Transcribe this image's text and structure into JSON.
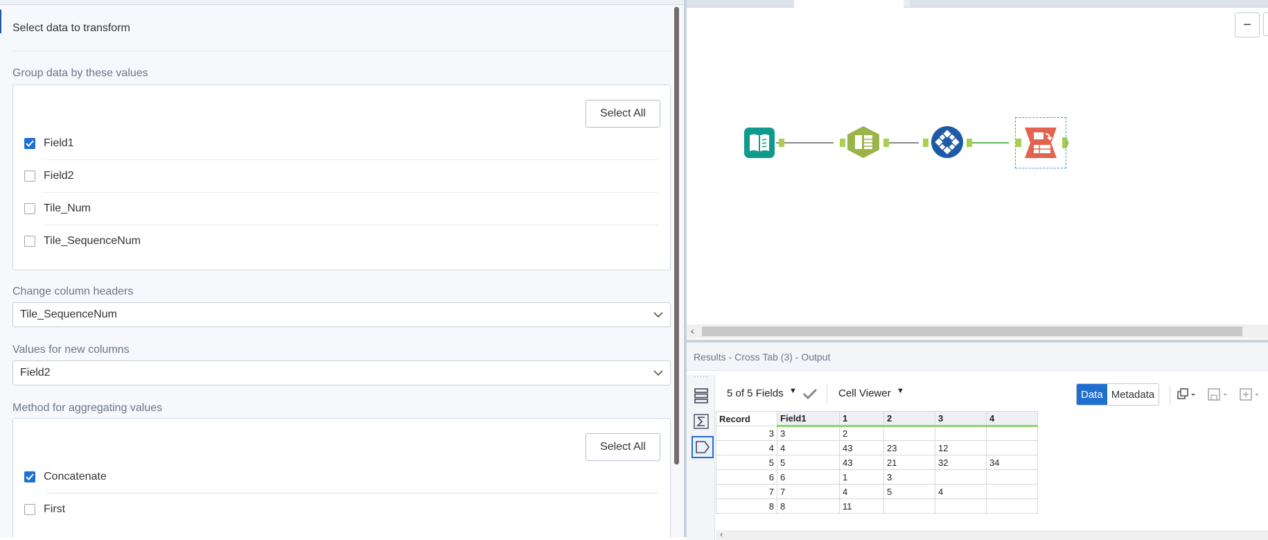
{
  "config": {
    "title": "Select data to transform",
    "group_section": "Group data by these values",
    "group_select_all": "Select All",
    "group_fields": [
      {
        "label": "Field1",
        "checked": true
      },
      {
        "label": "Field2",
        "checked": false
      },
      {
        "label": "Tile_Num",
        "checked": false
      },
      {
        "label": "Tile_SequenceNum",
        "checked": false
      }
    ],
    "headers_section": "Change column headers",
    "headers_value": "Tile_SequenceNum",
    "values_section": "Values for new columns",
    "values_value": "Field2",
    "method_section": "Method for aggregating values",
    "method_select_all": "Select All",
    "methods": [
      {
        "label": "Concatenate",
        "checked": true
      },
      {
        "label": "First",
        "checked": false
      }
    ]
  },
  "canvas": {
    "zoom_out_label": "−",
    "tools": [
      "input-data-tool",
      "text-to-columns-tool",
      "transpose-tool",
      "cross-tab-tool"
    ]
  },
  "results": {
    "header": "Results - Cross Tab (3) - Output",
    "fields_label": "5 of 5 Fields",
    "cell_viewer": "Cell Viewer",
    "tab_data": "Data",
    "tab_metadata": "Metadata",
    "columns": [
      "Record",
      "Field1",
      "1",
      "2",
      "3",
      "4"
    ],
    "rows": [
      [
        "3",
        "3",
        "2",
        "",
        "",
        ""
      ],
      [
        "4",
        "4",
        "43",
        "23",
        "12",
        ""
      ],
      [
        "5",
        "5",
        "43",
        "21",
        "32",
        "34"
      ],
      [
        "6",
        "6",
        "1",
        "3",
        "",
        ""
      ],
      [
        "7",
        "7",
        "4",
        "5",
        "4",
        ""
      ],
      [
        "8",
        "8",
        "11",
        "",
        "",
        ""
      ]
    ]
  },
  "colors": {
    "accent": "#1f6fd1",
    "input_tool": "#0f9a8e",
    "parse_tool": "#9cb34a",
    "transform_tool": "#1f5aa6",
    "crosstab_tool": "#e0644f",
    "connection_ok": "#5cb85c"
  }
}
